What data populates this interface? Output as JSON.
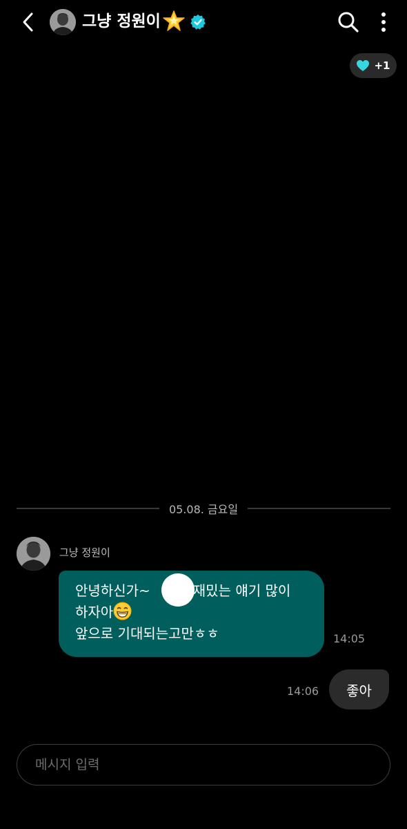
{
  "header": {
    "title": "그냥 정원이",
    "back_icon": "chevron-left-icon",
    "badge_icon": "glowing-star-icon",
    "verified_icon": "verified-badge-icon",
    "verified_color": "#1ec9e0",
    "search_icon": "search-icon",
    "more_icon": "more-vertical-icon"
  },
  "reaction": {
    "icon": "heart-icon",
    "icon_color": "#37d6e0",
    "count": "+1"
  },
  "date_divider": "05.08. 금요일",
  "messages": [
    {
      "direction": "incoming",
      "sender": "그냥 정원이",
      "lines": [
        "안녕하신가~",
        "재밌는 얘기 많이",
        "하자아",
        "앞으로 기대되는고만ㅎㅎ"
      ],
      "emoji": "grinning-face-icon",
      "time": "14:05",
      "bubble_color": "#005e5c"
    },
    {
      "direction": "outgoing",
      "text": "좋아",
      "time": "14:06",
      "bubble_color": "#2b2b2b"
    }
  ],
  "composer": {
    "placeholder": "메시지 입력"
  }
}
